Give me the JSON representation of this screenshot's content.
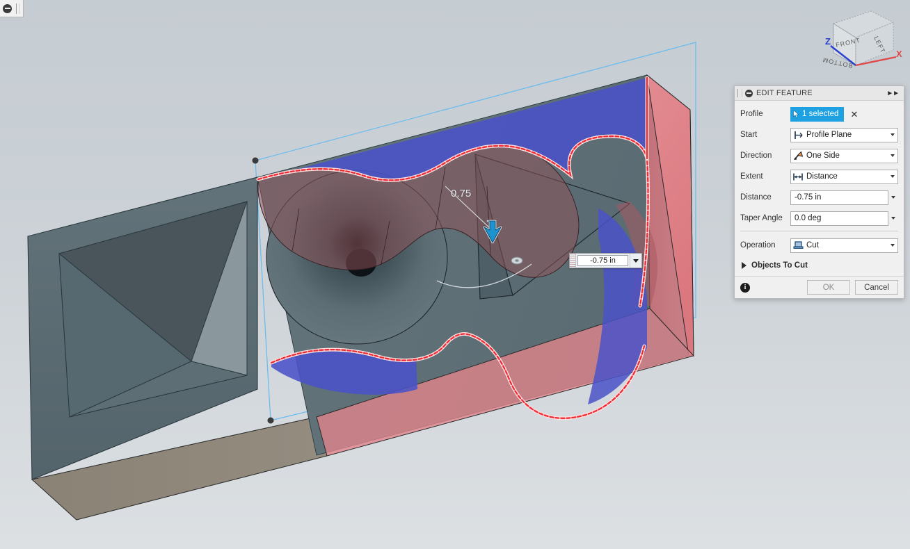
{
  "app": {
    "background_top": "#c5ccd2",
    "background_bottom": "#dce0e3"
  },
  "mini_toolbar": {
    "icon": "minus-circle-icon",
    "grip": "drag-grip"
  },
  "viewcube": {
    "faces": {
      "front": "FRONT",
      "right": "LEFT",
      "bottom": "BOTTOM"
    },
    "axes": [
      {
        "label": "Z",
        "color": "#2b3fd0"
      },
      {
        "label": "X",
        "color": "#e04a4a"
      }
    ]
  },
  "canvas": {
    "dimension_label": "0.75",
    "inline_input": {
      "value": "-0.75 in",
      "dropdown_icon": "chevron-down-icon",
      "grip_icon": "drag-grip-icon"
    },
    "manipulator_icon": "direction-arrow-handle",
    "colors": {
      "body": "#5a6a70",
      "base_face": "#8d8579",
      "profile_highlight": "#ed2b36",
      "selected_face": "#4a52c8",
      "cut_preview": "#e0737a",
      "sketch_plane_edge": "#6cbcee"
    }
  },
  "dialog": {
    "title": "EDIT FEATURE",
    "collapse_icon": "double-chevron-right-icon",
    "header_icon": "minus-circle-icon",
    "rows": [
      {
        "label": "Profile",
        "type": "selection",
        "chip_text": "1 selected",
        "chip_icon": "cursor-arrow-icon",
        "clear_icon": "close-x-icon",
        "chip_color": "#1da1e2"
      },
      {
        "label": "Start",
        "type": "dropdown",
        "value": "Profile Plane",
        "icon": "profile-plane-icon"
      },
      {
        "label": "Direction",
        "type": "dropdown",
        "value": "One Side",
        "icon": "one-side-arrow-icon"
      },
      {
        "label": "Extent",
        "type": "dropdown",
        "value": "Distance",
        "icon": "distance-arrow-icon"
      },
      {
        "label": "Distance",
        "type": "input",
        "value": "-0.75 in"
      },
      {
        "label": "Taper Angle",
        "type": "input",
        "value": "0.0 deg"
      }
    ],
    "operation": {
      "label": "Operation",
      "value": "Cut",
      "icon": "cut-operation-icon"
    },
    "objects_to_cut": {
      "label": "Objects To Cut",
      "expander_icon": "triangle-right-icon"
    },
    "footer": {
      "info_icon": "info-icon",
      "ok_label": "OK",
      "cancel_label": "Cancel"
    }
  }
}
